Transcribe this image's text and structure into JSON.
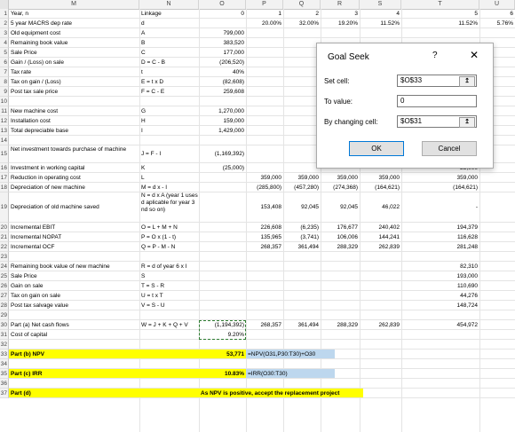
{
  "columns": [
    "M",
    "N",
    "O",
    "P",
    "Q",
    "R",
    "S",
    "T",
    "U"
  ],
  "rows": [
    {
      "n": "1",
      "m": "Year, n",
      "nn": "Linkage",
      "o": "0",
      "p": "1",
      "q": "2",
      "r": "3",
      "s": "4",
      "t": "5",
      "u": "6"
    },
    {
      "n": "2",
      "m": "5 year MACRS dep rate",
      "nn": "d",
      "o": "",
      "p": "20.00%",
      "q": "32.00%",
      "r": "19.20%",
      "s": "11.52%",
      "t": "11.52%",
      "u": "5.76%"
    },
    {
      "n": "3",
      "m": "Old equipment cost",
      "nn": "A",
      "o": "799,000"
    },
    {
      "n": "4",
      "m": "Remaining book value",
      "nn": "B",
      "o": "383,520"
    },
    {
      "n": "5",
      "m": "Sale Price",
      "nn": "C",
      "o": "177,000"
    },
    {
      "n": "6",
      "m": "Gain / (Loss) on sale",
      "nn": "D = C - B",
      "o": "(206,520)"
    },
    {
      "n": "7",
      "m": "Tax rate",
      "nn": "t",
      "o": "40%"
    },
    {
      "n": "8",
      "m": "Tax on gain / (Loss)",
      "nn": "E = t x D",
      "o": "(82,608)"
    },
    {
      "n": "9",
      "m": "Post tax sale price",
      "nn": "F = C - E",
      "o": "259,608"
    },
    {
      "n": "10",
      "m": "",
      "nn": "",
      "o": ""
    },
    {
      "n": "11",
      "m": "New machine cost",
      "nn": "G",
      "o": "1,270,000"
    },
    {
      "n": "12",
      "m": "Installation cost",
      "nn": "H",
      "o": "159,000"
    },
    {
      "n": "13",
      "m": "Total depreciable base",
      "nn": "I",
      "o": "1,429,000"
    },
    {
      "n": "14",
      "m": "",
      "nn": "",
      "o": ""
    },
    {
      "n": "15",
      "m": "Net investment towards purchase of machine",
      "nn": "J = F - I",
      "o": "(1,169,392)"
    },
    {
      "n": "16",
      "m": "Investment in working capital",
      "nn": "K",
      "o": "(25,000)",
      "t": "25,000"
    },
    {
      "n": "17",
      "m": "Reduction in operating cost",
      "nn": "L",
      "p": "359,000",
      "q": "359,000",
      "r": "359,000",
      "s": "359,000",
      "t": "359,000"
    },
    {
      "n": "18",
      "m": "Depreciation of new machine",
      "nn": "M = d x - I",
      "p": "(285,800)",
      "q": "(457,280)",
      "r": "(274,368)",
      "s": "(164,621)",
      "t": "(164,621)"
    },
    {
      "n": "19",
      "m": "Depreciation of old machine saved",
      "nn": "N = d x A (year 1 uses d aplicable for year 3 nd so on)",
      "p": "153,408",
      "q": "92,045",
      "r": "92,045",
      "s": "46,022",
      "t": "-"
    },
    {
      "n": "20",
      "m": "Incremental EBIT",
      "nn": "O = L + M + N",
      "p": "226,608",
      "q": "(6,235)",
      "r": "176,677",
      "s": "240,402",
      "t": "194,379"
    },
    {
      "n": "21",
      "m": "Incremental NOPAT",
      "nn": "P = O x (1 - t)",
      "p": "135,965",
      "q": "(3,741)",
      "r": "106,006",
      "s": "144,241",
      "t": "116,628"
    },
    {
      "n": "22",
      "m": "Incremental OCF",
      "nn": "Q = P - M - N",
      "p": "268,357",
      "q": "361,494",
      "r": "288,329",
      "s": "262,839",
      "t": "281,248"
    },
    {
      "n": "23",
      "m": "",
      "nn": ""
    },
    {
      "n": "24",
      "m": "Remaining book value of new machine",
      "nn": "R = d of year 6 x I",
      "t": "82,310"
    },
    {
      "n": "25",
      "m": "Sale Price",
      "nn": "S",
      "t": "193,000"
    },
    {
      "n": "26",
      "m": "Gain on sale",
      "nn": "T = S - R",
      "t": "110,690"
    },
    {
      "n": "27",
      "m": "Tax on gain on sale",
      "nn": "U = t x T",
      "t": "44,276"
    },
    {
      "n": "28",
      "m": "Post tax salvage value",
      "nn": "V = S - U",
      "t": "148,724"
    },
    {
      "n": "29",
      "m": "",
      "nn": ""
    },
    {
      "n": "30",
      "m": "Part (a) Net cash flows",
      "nn": "W = J + K + Q + V",
      "o": "(1,194,392)",
      "p": "268,357",
      "q": "361,494",
      "r": "288,329",
      "s": "262,839",
      "t": "454,972"
    },
    {
      "n": "31",
      "m": "Cost of capital",
      "nn": "",
      "o": "9.20%"
    },
    {
      "n": "32",
      "m": "",
      "nn": ""
    },
    {
      "n": "33",
      "m": "Part (b) NPV",
      "nn": "",
      "o": "53,771",
      "formula": "=NPV(O31,P30:T30)+O30"
    },
    {
      "n": "34",
      "m": "",
      "nn": ""
    },
    {
      "n": "35",
      "m": "Part (c) IRR",
      "nn": "",
      "o": "10.83%",
      "formula": "=IRR(O30:T30)"
    },
    {
      "n": "36",
      "m": "",
      "nn": ""
    },
    {
      "n": "37",
      "m": "Part (d)",
      "nn": "",
      "o": "As NPV is positive, accept the replacement project"
    }
  ],
  "dialog": {
    "title": "Goal Seek",
    "help": "?",
    "close": "✕",
    "set_cell_label": "Set cell:",
    "set_cell_value": "$O$33",
    "to_value_label": "To value:",
    "to_value_value": "0",
    "changing_cell_label": "By changing cell:",
    "changing_cell_value": "$O$31",
    "ok_label": "OK",
    "cancel_label": "Cancel",
    "ref_icon": "↥"
  }
}
